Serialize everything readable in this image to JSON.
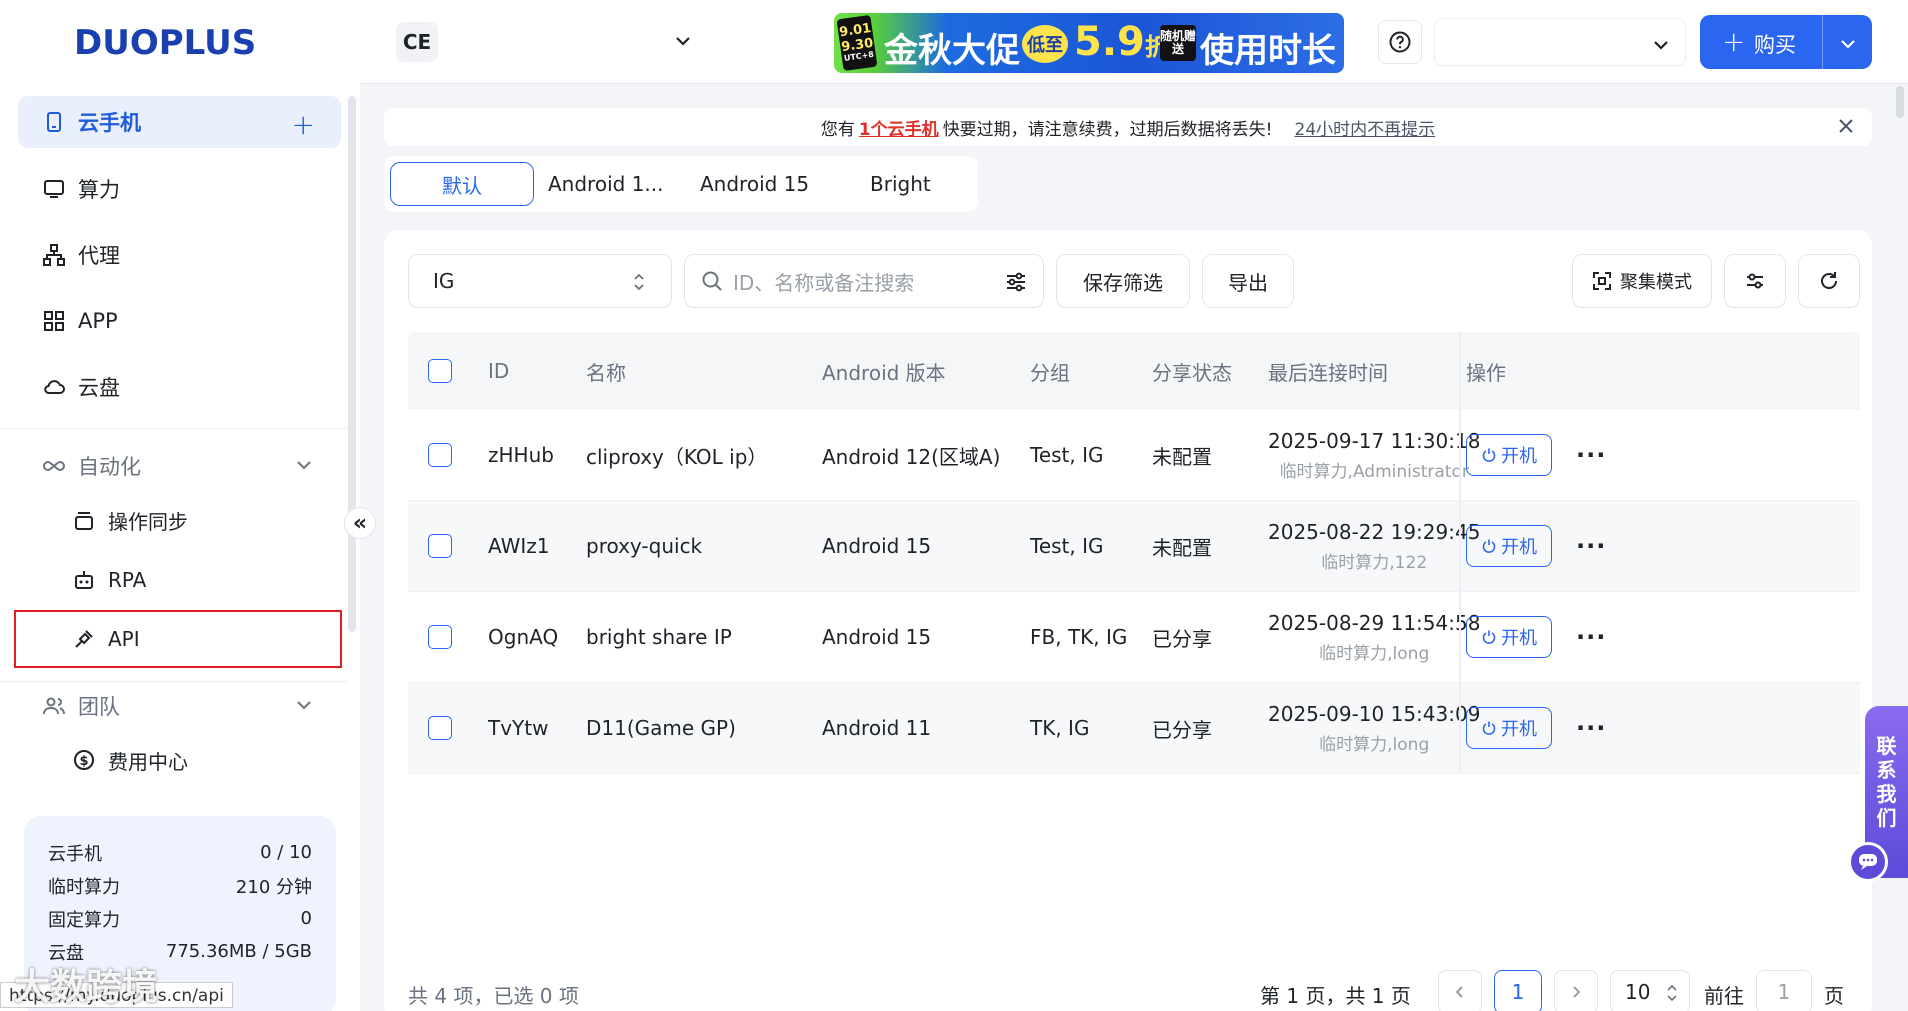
{
  "brand": {
    "logo_text": "DUOPLUS"
  },
  "sidebar": {
    "items": [
      {
        "label": "云手机",
        "icon": "phone-icon"
      },
      {
        "label": "算力",
        "icon": "monitor-icon"
      },
      {
        "label": "代理",
        "icon": "network-icon"
      },
      {
        "label": "APP",
        "icon": "grid-icon"
      },
      {
        "label": "云盘",
        "icon": "cloud-icon"
      }
    ],
    "automation": {
      "label": "自动化",
      "subitems": [
        "操作同步",
        "RPA",
        "API"
      ]
    },
    "team": {
      "label": "团队",
      "subitems": [
        "费用中心"
      ]
    },
    "usage": [
      {
        "label": "云手机",
        "value": "0 / 10"
      },
      {
        "label": "临时算力",
        "value": "210 分钟"
      },
      {
        "label": "固定算力",
        "value": "0"
      },
      {
        "label": "云盘",
        "value": "775.36MB / 5GB"
      }
    ],
    "collapse_glyph": "«"
  },
  "status_url": "https://my.duoplus.cn/api",
  "watermark": "大数跨境",
  "header": {
    "env_badge": "CE",
    "banner": {
      "date_top": "9.01",
      "date_bottom": "9.30",
      "date_tag": "UTC+8",
      "text_left": "金秋大促",
      "low": "低至",
      "discount": "5.9",
      "discount_unit": "折",
      "random": "随机赠送",
      "text_right": "使用时长"
    },
    "buy_label": "购买"
  },
  "notice": {
    "prefix": "您有",
    "highlight": "1个云手机",
    "suffix": "快要过期，请注意续费，过期后数据将丢失!",
    "dismiss": "24小时内不再提示"
  },
  "tabs": [
    "默认",
    "Android 1...",
    "Android 15",
    "Bright"
  ],
  "toolbar": {
    "group_value": "IG",
    "search_placeholder": "ID、名称或备注搜索",
    "save_filter": "保存筛选",
    "export": "导出",
    "focus_mode": "聚集模式"
  },
  "table": {
    "columns": [
      "ID",
      "名称",
      "Android 版本",
      "分组",
      "分享状态",
      "最后连接时间",
      "操作"
    ],
    "rows": [
      {
        "id": "zHHub",
        "name": "cliproxy（KOL ip）",
        "android": "Android 12(区域A)",
        "group": "Test, IG",
        "share": "未配置",
        "time": "2025-09-17 11:30:18",
        "time_sub": "临时算力,Administrator",
        "action": "开机"
      },
      {
        "id": "AWIz1",
        "name": "proxy-quick",
        "android": "Android 15",
        "group": "Test, IG",
        "share": "未配置",
        "time": "2025-08-22 19:29:45",
        "time_sub": "临时算力,122",
        "action": "开机"
      },
      {
        "id": "OgnAQ",
        "name": "bright share IP",
        "android": "Android 15",
        "group": "FB, TK, IG",
        "share": "已分享",
        "time": "2025-08-29 11:54:58",
        "time_sub": "临时算力,long",
        "action": "开机"
      },
      {
        "id": "TvYtw",
        "name": "D11(Game GP)",
        "android": "Android 11",
        "group": "TK, IG",
        "share": "已分享",
        "time": "2025-09-10 15:43:09",
        "time_sub": "临时算力,long",
        "action": "开机"
      }
    ],
    "more_glyph": "···"
  },
  "pagination": {
    "total": "共 4 项，已选 0 项",
    "page_info": "第 1 页，共 1 页",
    "current": "1",
    "page_size": "10",
    "goto_label": "前往",
    "goto_value": "1",
    "page_unit": "页"
  },
  "contact": {
    "label_chars": [
      "联",
      "系",
      "我",
      "们"
    ]
  },
  "colors": {
    "primary": "#2a66f0",
    "alert": "#e0302b",
    "contact": "#6a55e0"
  }
}
